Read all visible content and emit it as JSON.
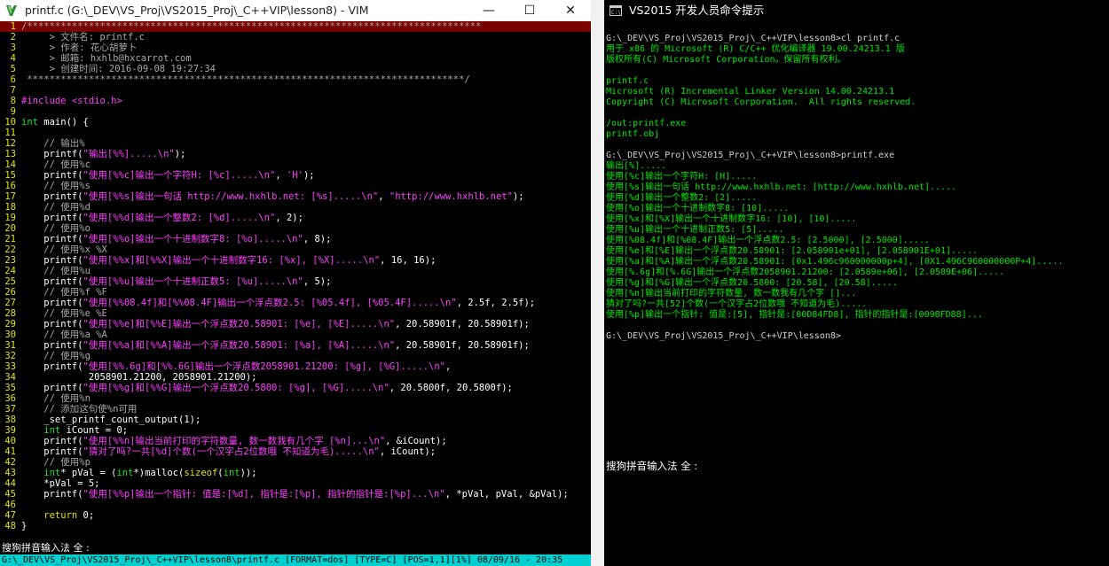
{
  "vim": {
    "title": "printf.c (G:\\_DEV\\VS_Proj\\VS2015_Proj\\_C++VIP\\lesson8) - VIM",
    "controls": {
      "minimize": "—",
      "maximize": "☐",
      "close": "✕"
    },
    "lines": [
      [
        {
          "t": "/*********************************************************************************",
          "c": "c-stars"
        }
      ],
      [
        {
          "t": "     > 文件名: printf.c",
          "c": "c-comment"
        }
      ],
      [
        {
          "t": "     > 作者: 花心胡萝卜",
          "c": "c-comment"
        }
      ],
      [
        {
          "t": "     > 邮箱: hxhlb@hxcarrot.com",
          "c": "c-comment"
        }
      ],
      [
        {
          "t": "     > 创建时间: 2016-09-08 19:27:34",
          "c": "c-comment"
        }
      ],
      [
        {
          "t": " ******************************************************************************/",
          "c": "c-stars"
        }
      ],
      [
        {
          "t": "",
          "c": "c-plain"
        }
      ],
      [
        {
          "t": "#include ",
          "c": "c-pre"
        },
        {
          "t": "<stdio.h>",
          "c": "c-string"
        }
      ],
      [
        {
          "t": "",
          "c": "c-plain"
        }
      ],
      [
        {
          "t": "int",
          "c": "c-type"
        },
        {
          "t": " main() {",
          "c": "c-plain"
        }
      ],
      [
        {
          "t": "",
          "c": "c-plain"
        }
      ],
      [
        {
          "t": "    // 输出%",
          "c": "c-comment"
        }
      ],
      [
        {
          "t": "    printf(",
          "c": "c-plain"
        },
        {
          "t": "\"输出[%%].....\\n\"",
          "c": "c-string"
        },
        {
          "t": ");",
          "c": "c-plain"
        }
      ],
      [
        {
          "t": "    // 使用%c",
          "c": "c-comment"
        }
      ],
      [
        {
          "t": "    printf(",
          "c": "c-plain"
        },
        {
          "t": "\"使用[%%c]输出一个字符H: [%c].....\\n\"",
          "c": "c-string"
        },
        {
          "t": ", ",
          "c": "c-plain"
        },
        {
          "t": "'H'",
          "c": "c-string"
        },
        {
          "t": ");",
          "c": "c-plain"
        }
      ],
      [
        {
          "t": "    // 使用%s",
          "c": "c-comment"
        }
      ],
      [
        {
          "t": "    printf(",
          "c": "c-plain"
        },
        {
          "t": "\"使用[%%s]输出一句话 http://www.hxhlb.net: [%s].....\\n\"",
          "c": "c-string"
        },
        {
          "t": ", ",
          "c": "c-plain"
        },
        {
          "t": "\"http://www.hxhlb.net\"",
          "c": "c-string"
        },
        {
          "t": ");",
          "c": "c-plain"
        }
      ],
      [
        {
          "t": "    // 使用%d",
          "c": "c-comment"
        }
      ],
      [
        {
          "t": "    printf(",
          "c": "c-plain"
        },
        {
          "t": "\"使用[%%d]输出一个整数2: [%d].....\\n\"",
          "c": "c-string"
        },
        {
          "t": ", 2);",
          "c": "c-plain"
        }
      ],
      [
        {
          "t": "    // 使用%o",
          "c": "c-comment"
        }
      ],
      [
        {
          "t": "    printf(",
          "c": "c-plain"
        },
        {
          "t": "\"使用[%%o]输出一个十进制数字8: [%o].....\\n\"",
          "c": "c-string"
        },
        {
          "t": ", 8);",
          "c": "c-plain"
        }
      ],
      [
        {
          "t": "    // 使用%x %X",
          "c": "c-comment"
        }
      ],
      [
        {
          "t": "    printf(",
          "c": "c-plain"
        },
        {
          "t": "\"使用[%%x]和[%%X]输出一个十进制数字16: [%x], [%X].....\\n\"",
          "c": "c-string"
        },
        {
          "t": ", 16, 16);",
          "c": "c-plain"
        }
      ],
      [
        {
          "t": "    // 使用%u",
          "c": "c-comment"
        }
      ],
      [
        {
          "t": "    printf(",
          "c": "c-plain"
        },
        {
          "t": "\"使用[%%u]输出一个十进制正数5: [%u].....\\n\"",
          "c": "c-string"
        },
        {
          "t": ", 5);",
          "c": "c-plain"
        }
      ],
      [
        {
          "t": "    // 使用%f %F",
          "c": "c-comment"
        }
      ],
      [
        {
          "t": "    printf(",
          "c": "c-plain"
        },
        {
          "t": "\"使用[%%08.4f]和[%%08.4F]输出一个浮点数2.5: [%05.4f], [%05.4F].....\\n\"",
          "c": "c-string"
        },
        {
          "t": ", 2.5f, 2.5f);",
          "c": "c-plain"
        }
      ],
      [
        {
          "t": "    // 使用%e %E",
          "c": "c-comment"
        }
      ],
      [
        {
          "t": "    printf(",
          "c": "c-plain"
        },
        {
          "t": "\"使用[%%e]和[%%E]输出一个浮点数20.58901: [%e], [%E].....\\n\"",
          "c": "c-string"
        },
        {
          "t": ", 20.58901f, 20.58901f);",
          "c": "c-plain"
        }
      ],
      [
        {
          "t": "    // 使用%a %A",
          "c": "c-comment"
        }
      ],
      [
        {
          "t": "    printf(",
          "c": "c-plain"
        },
        {
          "t": "\"使用[%%a]和[%%A]输出一个浮点数20.58901: [%a], [%A].....\\n\"",
          "c": "c-string"
        },
        {
          "t": ", 20.58901f, 20.58901f);",
          "c": "c-plain"
        }
      ],
      [
        {
          "t": "    // 使用%g",
          "c": "c-comment"
        }
      ],
      [
        {
          "t": "    printf(",
          "c": "c-plain"
        },
        {
          "t": "\"使用[%%.6g]和[%%.6G]输出一个浮点数2058901.21200: [%g], [%G].....\\n\"",
          "c": "c-string"
        },
        {
          "t": ",",
          "c": "c-plain"
        }
      ],
      [
        {
          "t": "            2058901.21200, 2058901.21200);",
          "c": "c-plain"
        }
      ],
      [
        {
          "t": "    printf(",
          "c": "c-plain"
        },
        {
          "t": "\"使用[%%g]和[%%G]输出一个浮点数20.5800: [%g], [%G].....\\n\"",
          "c": "c-string"
        },
        {
          "t": ", 20.5800f, 20.5800f);",
          "c": "c-plain"
        }
      ],
      [
        {
          "t": "    // 使用%n",
          "c": "c-comment"
        }
      ],
      [
        {
          "t": "    // 添加这句使%n可用",
          "c": "c-comment"
        }
      ],
      [
        {
          "t": "    _set_printf_count_output(1);",
          "c": "c-plain"
        }
      ],
      [
        {
          "t": "    int",
          "c": "c-type"
        },
        {
          "t": " iCount = 0;",
          "c": "c-plain"
        }
      ],
      [
        {
          "t": "    printf(",
          "c": "c-plain"
        },
        {
          "t": "\"使用[%%n]输出当前打印的字符数量, 数一数我有几个字 [%n]...\\n\"",
          "c": "c-string"
        },
        {
          "t": ", &iCount);",
          "c": "c-plain"
        }
      ],
      [
        {
          "t": "    printf(",
          "c": "c-plain"
        },
        {
          "t": "\"猜对了吗?一共[%d]个数(一个汉字占2位数哦 不知道为毛).....\\n\"",
          "c": "c-string"
        },
        {
          "t": ", iCount);",
          "c": "c-plain"
        }
      ],
      [
        {
          "t": "    // 使用%p",
          "c": "c-comment"
        }
      ],
      [
        {
          "t": "    int",
          "c": "c-type"
        },
        {
          "t": "* pVal = (",
          "c": "c-plain"
        },
        {
          "t": "int",
          "c": "c-type"
        },
        {
          "t": "*)malloc(",
          "c": "c-plain"
        },
        {
          "t": "sizeof",
          "c": "c-kw"
        },
        {
          "t": "(",
          "c": "c-plain"
        },
        {
          "t": "int",
          "c": "c-type"
        },
        {
          "t": "));",
          "c": "c-plain"
        }
      ],
      [
        {
          "t": "    *pVal = 5;",
          "c": "c-plain"
        }
      ],
      [
        {
          "t": "    printf(",
          "c": "c-plain"
        },
        {
          "t": "\"使用[%%p]输出一个指针: 值是:[%d], 指针是:[%p], 指针的指针是:[%p]...\\n\"",
          "c": "c-string"
        },
        {
          "t": ", *pVal, pVal, &pVal);",
          "c": "c-plain"
        }
      ],
      [
        {
          "t": "",
          "c": "c-plain"
        }
      ],
      [
        {
          "t": "    return",
          "c": "c-kw"
        },
        {
          "t": " 0;",
          "c": "c-plain"
        }
      ],
      [
        {
          "t": "}",
          "c": "c-plain"
        }
      ]
    ],
    "ime": "搜狗拼音输入法 全 :",
    "status": "G:\\_DEV\\VS_Proj\\VS2015_Proj\\_C++VIP\\lesson8\\printf.c [FORMAT=dos] [TYPE=C] [POS=1,1][1%] 08/09/16 - 20:35"
  },
  "cmd": {
    "title": "VS2015 开发人员命令提示",
    "lines": [
      {
        "t": "G:\\_DEV\\VS_Proj\\VS2015_Proj\\_C++VIP\\lesson8>cl printf.c",
        "c": "grey"
      },
      {
        "t": "用于 x86 的 Microsoft (R) C/C++ 优化编译器 19.00.24213.1 版",
        "c": "green"
      },
      {
        "t": "版权所有(C) Microsoft Corporation。保留所有权利。",
        "c": "green"
      },
      {
        "t": "",
        "c": "green"
      },
      {
        "t": "printf.c",
        "c": "green"
      },
      {
        "t": "Microsoft (R) Incremental Linker Version 14.00.24213.1",
        "c": "green"
      },
      {
        "t": "Copyright (C) Microsoft Corporation.  All rights reserved.",
        "c": "green"
      },
      {
        "t": "",
        "c": "green"
      },
      {
        "t": "/out:printf.exe",
        "c": "green"
      },
      {
        "t": "printf.obj",
        "c": "green"
      },
      {
        "t": "",
        "c": "green"
      },
      {
        "t": "G:\\_DEV\\VS_Proj\\VS2015_Proj\\_C++VIP\\lesson8>printf.exe",
        "c": "grey"
      },
      {
        "t": "输出[%].....",
        "c": "green"
      },
      {
        "t": "使用[%c]输出一个字符H: [H].....",
        "c": "green"
      },
      {
        "t": "使用[%s]输出一句话 http://www.hxhlb.net: [http://www.hxhlb.net].....",
        "c": "green"
      },
      {
        "t": "使用[%d]输出一个整数2: [2].....",
        "c": "green"
      },
      {
        "t": "使用[%o]输出一个十进制数字8: [10].....",
        "c": "green"
      },
      {
        "t": "使用[%x]和[%X]输出一个十进制数字16: [10], [10].....",
        "c": "green"
      },
      {
        "t": "使用[%u]输出一个十进制正数5: [5].....",
        "c": "green"
      },
      {
        "t": "使用[%08.4f]和[%08.4F]输出一个浮点数2.5: [2.5000], [2.5000].....",
        "c": "green"
      },
      {
        "t": "使用[%e]和[%E]输出一个浮点数20.58901: [2.058901e+01], [2.058901E+01].....",
        "c": "green"
      },
      {
        "t": "使用[%a]和[%A]输出一个浮点数20.58901: [0x1.496c960000000p+4], [0X1.496C960000000P+4].....",
        "c": "green"
      },
      {
        "t": "使用[%.6g]和[%.6G]输出一个浮点数2058901.21200: [2.0589e+06], [2.0589E+06].....",
        "c": "green"
      },
      {
        "t": "使用[%g]和[%G]输出一个浮点数20.5800: [20.58], [20.58].....",
        "c": "green"
      },
      {
        "t": "使用[%n]输出当前打印的字符数量, 数一数我有几个字 []...",
        "c": "green"
      },
      {
        "t": "猜对了吗?一共[52]个数(一个汉字占2位数哦 不知道为毛).....",
        "c": "green"
      },
      {
        "t": "使用[%p]输出一个指针: 值是:[5], 指针是:[00D84FD8], 指针的指针是:[0098FD88]...",
        "c": "green"
      },
      {
        "t": "",
        "c": "green"
      },
      {
        "t": "G:\\_DEV\\VS_Proj\\VS2015_Proj\\_C++VIP\\lesson8>",
        "c": "grey"
      }
    ],
    "ime": "搜狗拼音输入法 全 :"
  }
}
